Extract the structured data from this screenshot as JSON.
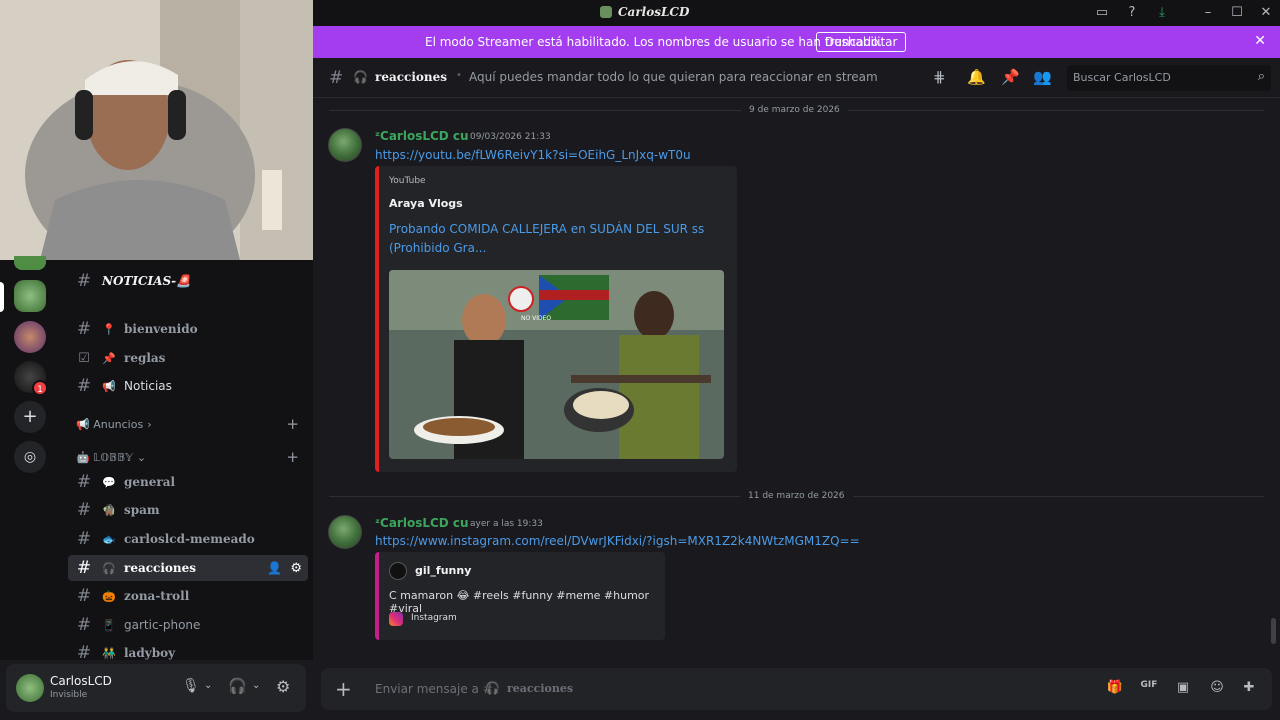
{
  "titlebar": {
    "title": "CarlosLCD"
  },
  "banner": {
    "text": "El modo Streamer está habilitado. Los nombres de usuario se han truncado.",
    "button": "Deshabilitar"
  },
  "sidebar": {
    "server_title": "𝑵𝑶𝑻𝑰𝑪𝑰𝑨𝑺-🚨",
    "channels_top": [
      {
        "emoji": "📍",
        "name": "bienvenido"
      },
      {
        "emoji": "📌",
        "name": "reglas"
      },
      {
        "emoji": "📢",
        "name": "Noticias"
      }
    ],
    "category1": "📢 Anuncios",
    "category2": "🤖 𝕃𝕆𝔹𝔹𝕐",
    "channels_lobby": [
      {
        "emoji": "💬",
        "name": "general"
      },
      {
        "emoji": "🧌",
        "name": "spam"
      },
      {
        "emoji": "🐟",
        "name": "carloslcd-memeado"
      },
      {
        "emoji": "🎧",
        "name": "reacciones"
      },
      {
        "emoji": "🎃",
        "name": "zona-troll"
      },
      {
        "emoji": "📱",
        "name": "gartic-phone"
      },
      {
        "emoji": "👬",
        "name": "ladyboy"
      }
    ],
    "badge": "1"
  },
  "user": {
    "name": "CarlosLCD",
    "status": "Invisible"
  },
  "channel_header": {
    "name": "reacciones",
    "topic": "Aquí puedes mandar todo lo que quieran para reaccionar en stream",
    "search_placeholder": "Buscar CarlosLCD"
  },
  "messages": [
    {
      "date_divider": "9 de marzo de 2026",
      "author": "ᶻCarlosLCD cu",
      "timestamp": "09/03/2026 21:33",
      "link": "https://youtu.be/fLW6ReivY1k?si=OEihG_LnJxq-wT0u",
      "embed": {
        "provider": "YouTube",
        "author": "Araya Vlogs",
        "title_line1": "Probando COMIDA CALLEJERA en SUDÁN DEL SUR ss",
        "title_line2": "(Prohibido Gra...",
        "thumb_sign": "NO VIDEO"
      }
    },
    {
      "date_divider": "11 de marzo de 2026",
      "author": "ᶻCarlosLCD cu",
      "timestamp": "ayer a las 19:33",
      "link": "https://www.instagram.com/reel/DVwrJKFidxi/?igsh=MXR1Z2k4NWtzMGM1ZQ==",
      "embed": {
        "author": "gil_funny",
        "text": "C mamaron 😂 #reels #funny #meme #humor #viral",
        "provider": "Instagram"
      }
    }
  ],
  "composer": {
    "placeholder": "Enviar mensaje a #",
    "channel": "reacciones"
  },
  "colors": {
    "banner": "#a43cf0",
    "link": "#4a9be8",
    "username": "#3ba55d",
    "yt_bar": "#e02020",
    "ig_bar": "#c31e8a"
  }
}
